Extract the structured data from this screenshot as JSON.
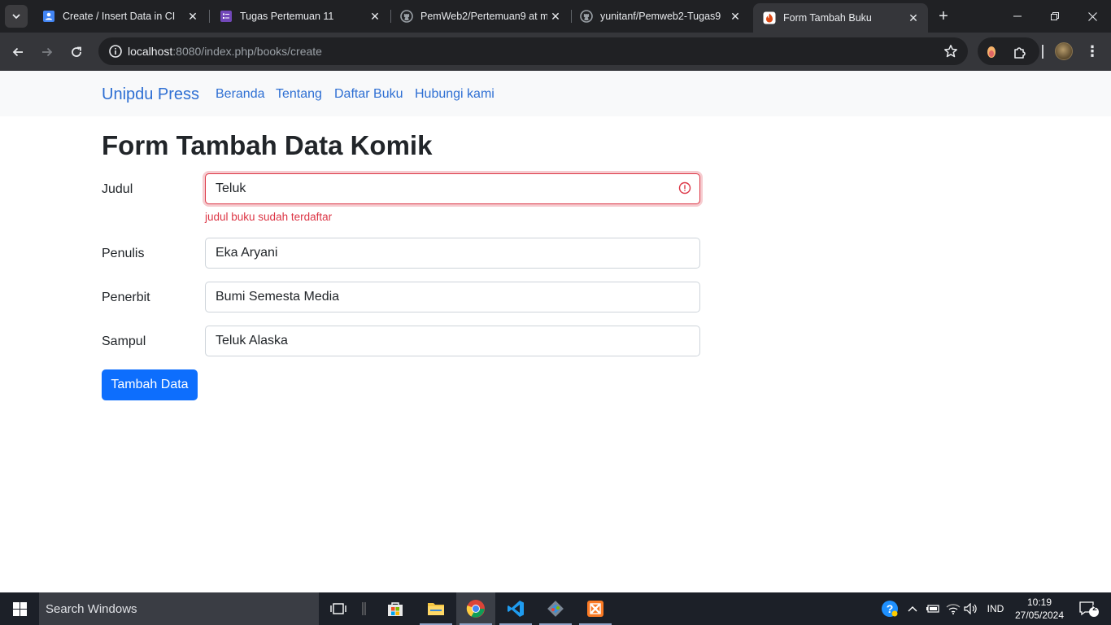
{
  "browser": {
    "tabs": [
      {
        "title": "Create / Insert Data in CI",
        "icon": "google-docs-icon",
        "active": false
      },
      {
        "title": "Tugas Pertemuan 11",
        "icon": "form-icon",
        "active": false
      },
      {
        "title": "PemWeb2/Pertemuan9 at m",
        "icon": "github-icon",
        "active": false
      },
      {
        "title": "yunitanf/Pemweb2-Tugas9",
        "icon": "github-icon",
        "active": false
      },
      {
        "title": "Form Tambah Buku",
        "icon": "codeigniter-icon",
        "active": true
      }
    ],
    "address": {
      "host": "localhost",
      "rest": ":8080/index.php/books/create"
    }
  },
  "navbar": {
    "brand": "Unipdu Press",
    "links": [
      "Beranda",
      "Tentang",
      "Daftar Buku",
      "Hubungi kami"
    ]
  },
  "form": {
    "title": "Form Tambah Data Komik",
    "fields": [
      {
        "label": "Judul",
        "value": "Teluk",
        "invalid": true,
        "feedback": "judul buku sudah terdaftar"
      },
      {
        "label": "Penulis",
        "value": "Eka Aryani"
      },
      {
        "label": "Penerbit",
        "value": "Bumi Semesta Media"
      },
      {
        "label": "Sampul",
        "value": "Teluk Alaska"
      }
    ],
    "submit_label": "Tambah Data"
  },
  "taskbar": {
    "search_placeholder": "Search Windows",
    "language": "IND",
    "time": "10:19",
    "date": "27/05/2024",
    "notification_count": "2"
  },
  "colors": {
    "accent": "#0d6efd",
    "link": "#2e6fd3",
    "danger": "#dc3545",
    "chrome_dark": "#202124",
    "chrome_toolbar": "#35363a"
  }
}
